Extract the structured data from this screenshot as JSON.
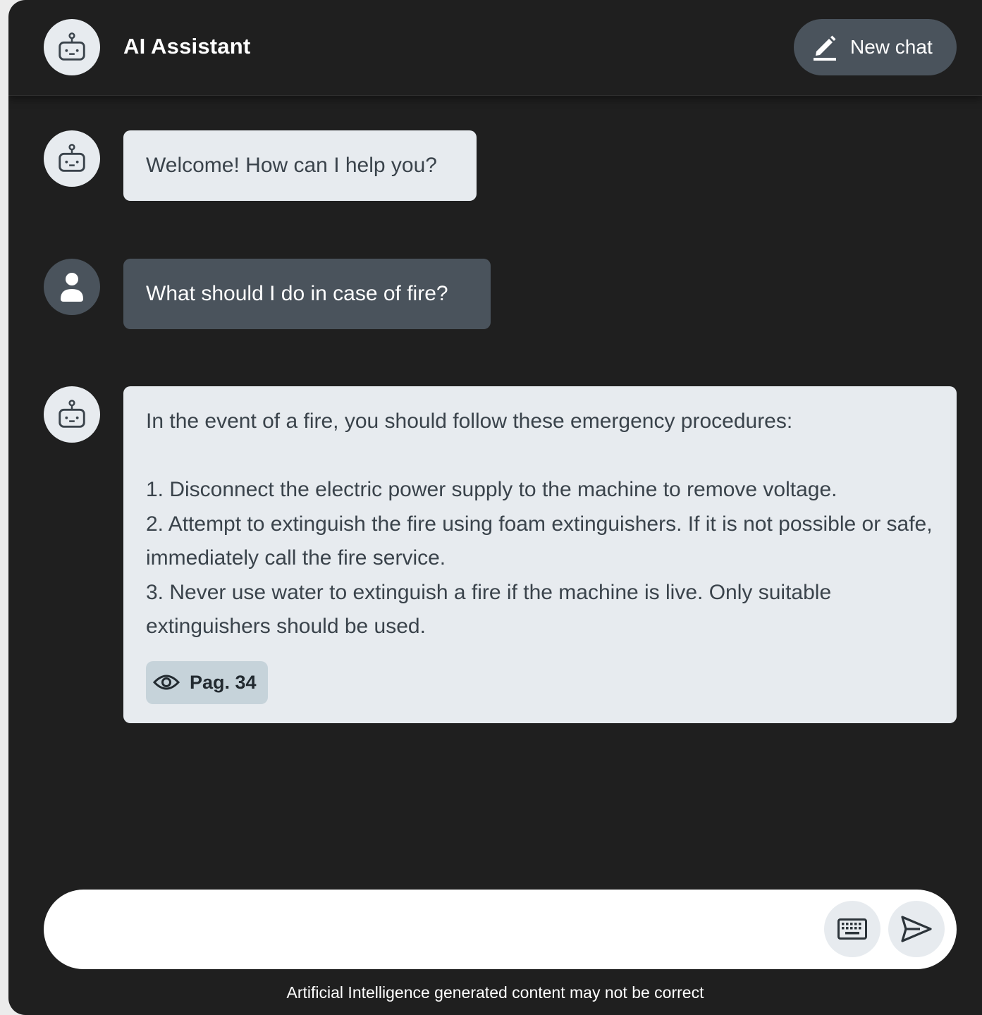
{
  "header": {
    "title": "AI Assistant",
    "new_chat_label": "New chat",
    "avatar_icon": "robot-icon",
    "new_chat_icon": "edit-pencil-icon"
  },
  "messages": [
    {
      "role": "assistant",
      "avatar_icon": "robot-icon",
      "text": "Welcome! How can I help you?"
    },
    {
      "role": "user",
      "avatar_icon": "person-icon",
      "text": "What should I do in case of fire?"
    },
    {
      "role": "assistant",
      "avatar_icon": "robot-icon",
      "text": "In the event of a fire, you should follow these emergency procedures:\n\n1. Disconnect the electric power supply to the machine to remove voltage.\n2. Attempt to extinguish the fire using foam extinguishers. If it is not possible or safe, immediately call the fire service.\n3. Never use water to extinguish a fire if the machine is live. Only suitable extinguishers should be used.",
      "source": {
        "icon": "eye-icon",
        "label": "Pag. 34"
      }
    }
  ],
  "composer": {
    "value": "",
    "placeholder": "",
    "keyboard_icon": "keyboard-icon",
    "send_icon": "send-icon"
  },
  "footer": {
    "disclaimer": "Artificial Intelligence generated content may not be correct"
  },
  "colors": {
    "background": "#1f1f1f",
    "bot_bubble": "#e7ebef",
    "user_bubble": "#4a535c",
    "source_chip": "#c6d3da",
    "text_dark": "#3a434b"
  }
}
